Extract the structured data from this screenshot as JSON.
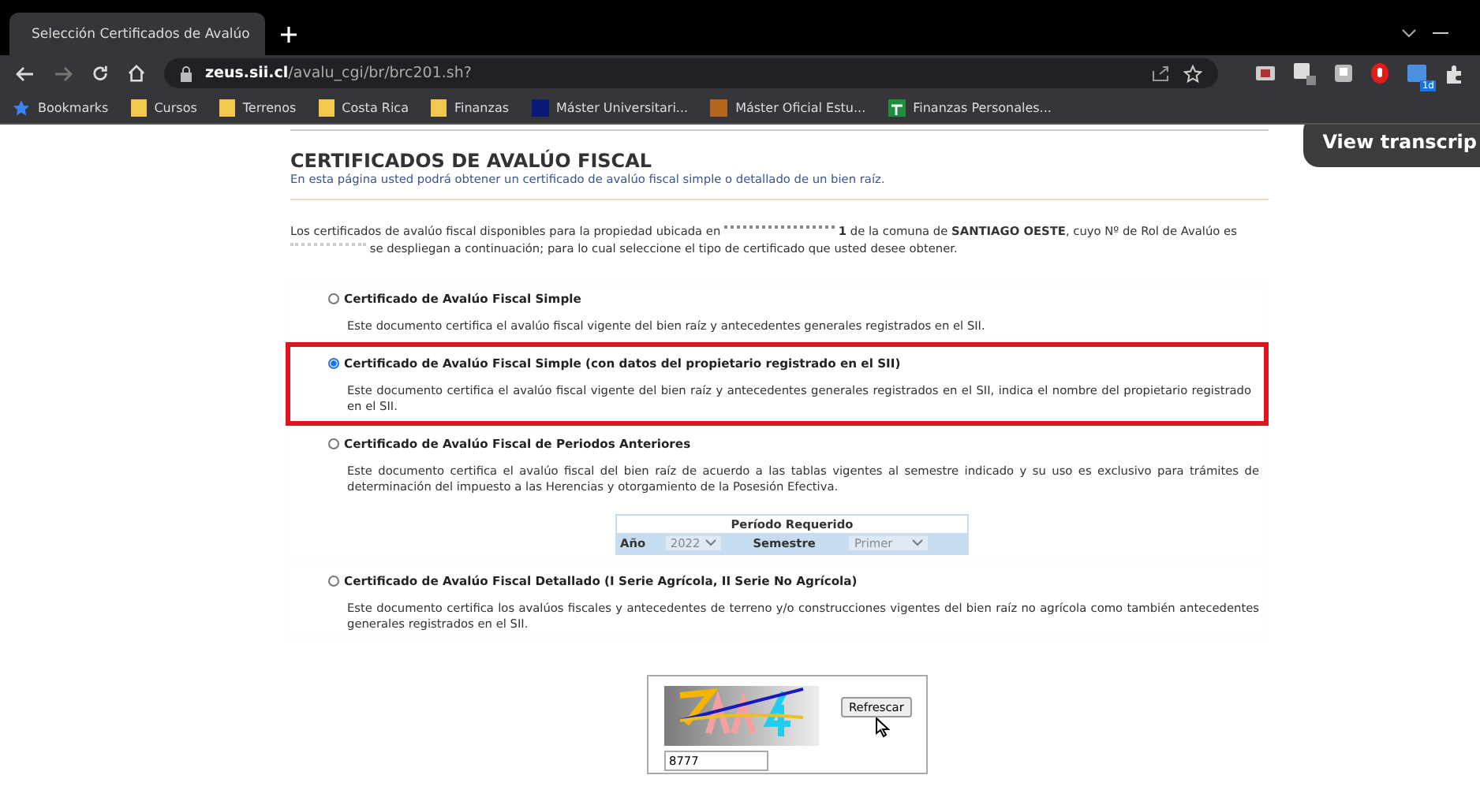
{
  "browser": {
    "tab": {
      "title": "Selección Certificados de Avalúo"
    },
    "url": {
      "host": "zeus.sii.cl",
      "path": "/avalu_cgi/br/brc201.sh?"
    },
    "bookmarks": [
      {
        "label": "Bookmarks",
        "kind": "star"
      },
      {
        "label": "Cursos",
        "kind": "folder"
      },
      {
        "label": "Terrenos",
        "kind": "folder"
      },
      {
        "label": "Costa Rica",
        "kind": "folder"
      },
      {
        "label": "Finanzas",
        "kind": "folder"
      },
      {
        "label": "Máster Universitari...",
        "kind": "navy"
      },
      {
        "label": "Máster Oficial Estu...",
        "kind": "brown"
      },
      {
        "label": "Finanzas Personales...",
        "kind": "sheet"
      }
    ],
    "extension_badge": "1d"
  },
  "overlay": {
    "label": "View transcrip"
  },
  "page": {
    "title": "CERTIFICADOS DE AVALÚO FISCAL",
    "subtitle": "En esta página usted podrá obtener un certificado de avalúo fiscal simple o detallado de un bien raíz.",
    "intro_start": "Los certificados de avalúo fiscal disponibles para la propiedad ubicada en",
    "intro_middle": "**1** de la comuna de **SANTIAGO OESTE**, cuyo Nº de Rol de Avalúo es",
    "intro_end": "se despliegan a continuación; para lo cual seleccione el tipo de certificado que usted desee obtener.",
    "options": [
      {
        "label": "Certificado de Avalúo Fiscal Simple",
        "description": "Este documento certifica el avalúo fiscal vigente del bien raíz y antecedentes generales registrados en el SII.",
        "selected": false,
        "highlighted": false
      },
      {
        "label": "Certificado de Avalúo Fiscal Simple (con datos del propietario registrado en el SII)",
        "description": "Este documento certifica el avalúo fiscal vigente del bien raíz y antecedentes generales registrados en el SII, indica el nombre del propietario registrado en el SII.",
        "selected": true,
        "highlighted": true
      },
      {
        "label": "Certificado de Avalúo Fiscal de Periodos Anteriores",
        "description": "Este documento certifica el avalúo fiscal del bien raíz de acuerdo a las tablas vigentes al semestre indicado y su uso es exclusivo para trámites de determinación del impuesto a las Herencias y otorgamiento de la Posesión Efectiva.",
        "selected": false,
        "highlighted": false,
        "period": {
          "title": "Período Requerido",
          "year_label": "Año",
          "year_value": "2022",
          "semester_label": "Semestre",
          "semester_value": "Primer"
        }
      },
      {
        "label": "Certificado de Avalúo Fiscal Detallado (I Serie Agrícola, II Serie No Agrícola)",
        "description": "Este documento certifica los avalúos fiscales y antecedentes de terreno y/o construcciones vigentes del bien raíz no agrícola como también antecedentes generales registrados en el SII.",
        "selected": false,
        "highlighted": false
      }
    ],
    "captcha": {
      "button": "Refrescar",
      "value": "8777"
    }
  }
}
